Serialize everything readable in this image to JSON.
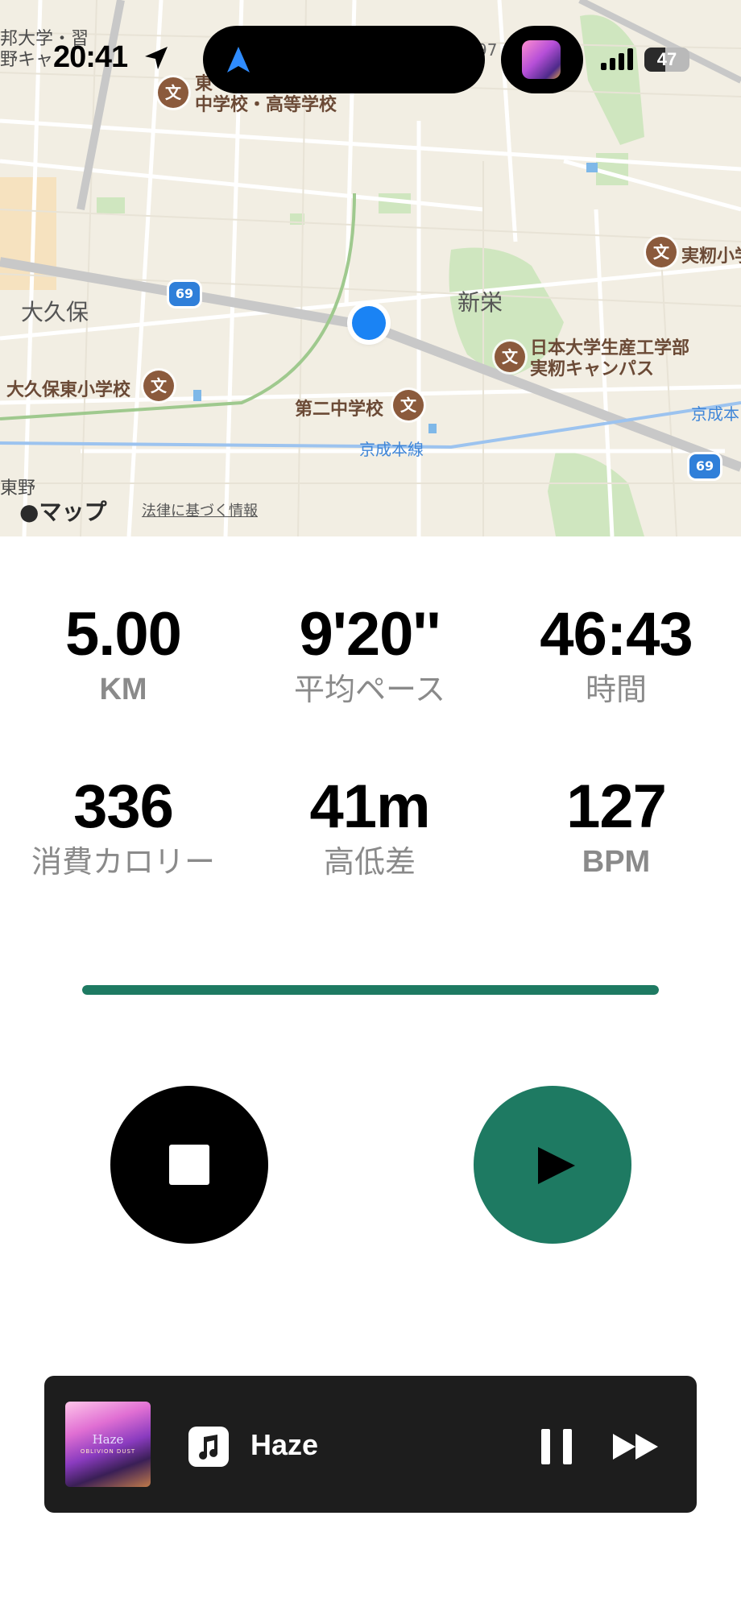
{
  "status_bar": {
    "time": "20:41",
    "battery": "47",
    "battery_level_percent": 47
  },
  "map": {
    "labels": {
      "top_left": "邦大学・習\n野キャ",
      "school_1": "東\n中学校・高等学校",
      "okubo": "大久保",
      "shinei": "新栄",
      "jissen": "実籾小学",
      "nihon_univ": "日本大学生産工学部\n実籾キャンパス",
      "okubo_higashi": "大久保東小学校",
      "daini": "第二中学校",
      "keisei_line": "京成本線",
      "keisei_right": "京成本",
      "bottom_left": "東野",
      "top_number": "97"
    },
    "route_number": "69",
    "poi_icon_char": "文",
    "attribution": "マップ",
    "legal": "法律に基づく情報"
  },
  "stats": {
    "distance": {
      "value": "5.00",
      "label": "KM"
    },
    "pace": {
      "value": "9'20''",
      "label": "平均ペース"
    },
    "time": {
      "value": "46:43",
      "label": "時間"
    },
    "calories": {
      "value": "336",
      "label": "消費カロリー"
    },
    "elevation": {
      "value": "41m",
      "label": "高低差"
    },
    "heart_rate": {
      "value": "127",
      "label": "BPM"
    }
  },
  "progress": {
    "percent": 100,
    "color": "#1e7a62"
  },
  "controls": {
    "stop_color": "#000000",
    "play_color": "#1e7a62"
  },
  "mini_player": {
    "title": "Haze",
    "artwork_title": "Haze",
    "artwork_subtitle": "OBLIVION DUST",
    "icons": [
      "music-note-icon",
      "pause-icon",
      "forward-icon"
    ]
  },
  "colors": {
    "accent": "#1e7a62",
    "user_location": "#1a83f4",
    "poi": "#8b5a3c",
    "route_shield": "#2f7fd9"
  }
}
